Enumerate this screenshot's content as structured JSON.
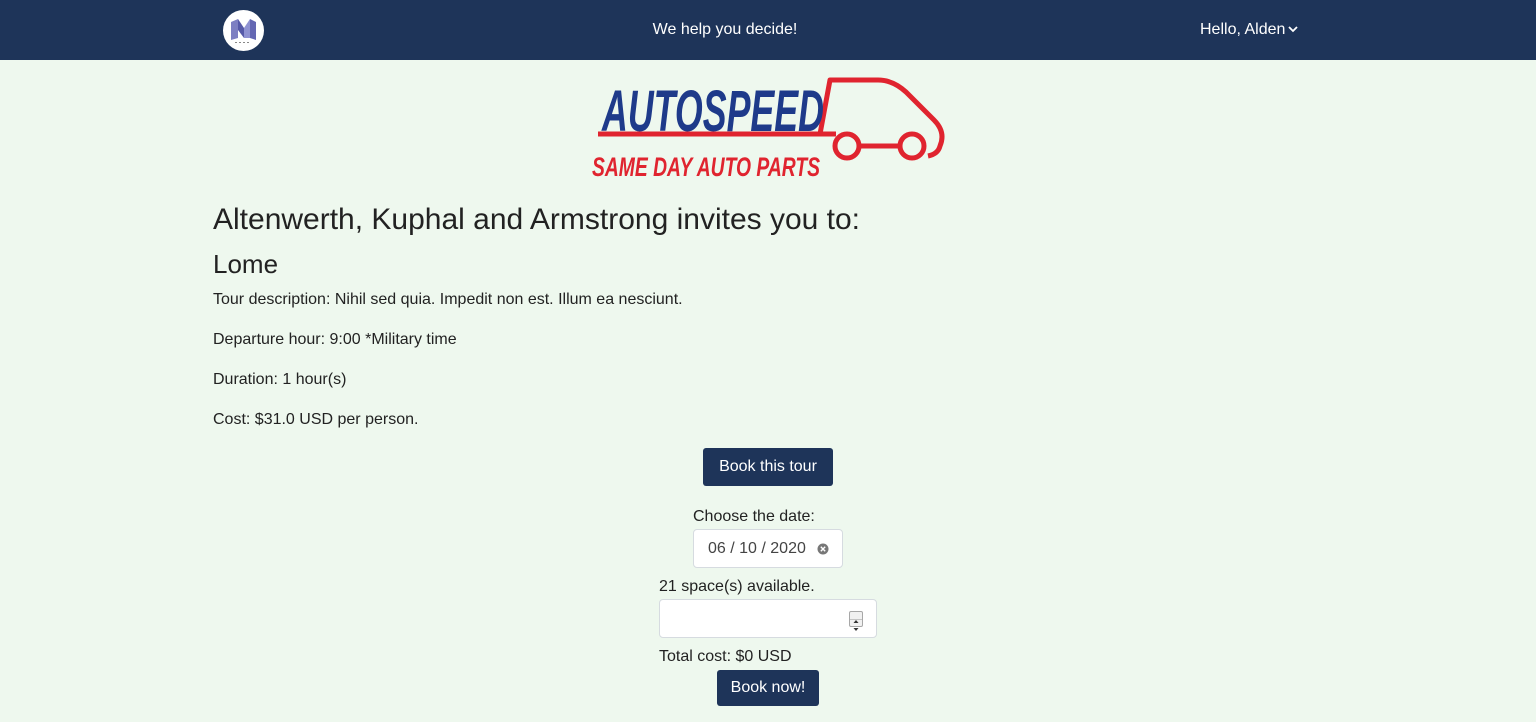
{
  "navbar": {
    "tagline": "We help you decide!",
    "user_greeting": "Hello, Alden",
    "logo_icon": "site-logo-icon",
    "dropdown_icon": "chevron-down-icon"
  },
  "brand": {
    "name": "AUTOSPEED",
    "subtitle": "SAME DAY AUTO PARTS",
    "colors": {
      "blue": "#1e3a8a",
      "red": "#e0242f"
    }
  },
  "tour": {
    "invite_line": "Altenwerth, Kuphal and Armstrong invites you to:",
    "name": "Lome",
    "description": "Tour description: Nihil sed quia. Impedit non est. Illum ea nesciunt.",
    "departure": "Departure hour: 9:00 *Military time",
    "duration": "Duration: 1 hour(s)",
    "cost": "Cost: $31.0 USD per person."
  },
  "booking": {
    "book_tour_label": "Book this tour",
    "choose_date_label": "Choose the date:",
    "date_value": "06 / 10 / 2020",
    "spaces_label": "21 space(s) available.",
    "quantity_value": "",
    "total_cost": "Total cost: $0 USD",
    "book_now_label": "Book now!"
  },
  "colors": {
    "navbar_bg": "#1e3459",
    "page_bg": "#eef8ee",
    "button_bg": "#1e3459"
  }
}
